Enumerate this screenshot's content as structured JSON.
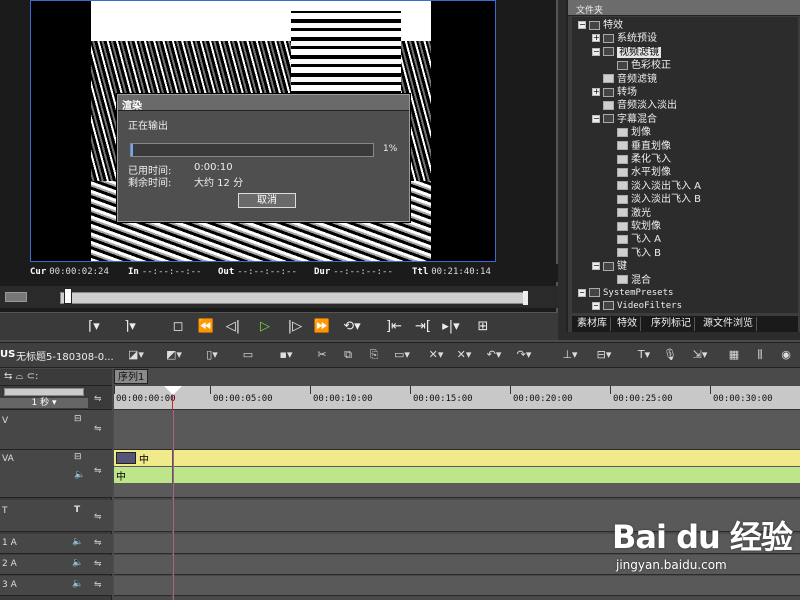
{
  "preview": {
    "timecodes": [
      {
        "label": "Cur",
        "value": "00:00:02:24"
      },
      {
        "label": "In",
        "value": "--:--:--:--"
      },
      {
        "label": "Out",
        "value": "--:--:--:--"
      },
      {
        "label": "Dur",
        "value": "--:--:--:--"
      },
      {
        "label": "Ttl",
        "value": "00:21:40:14"
      }
    ],
    "scrub_progress": 0.01
  },
  "dialog": {
    "title": "渲染",
    "status": "正在输出",
    "progress": 0.01,
    "progress_text": "1%",
    "elapsed_label": "已用时间:",
    "elapsed_value": "0:00:10",
    "remaining_label": "剩余时间:",
    "remaining_value": "大约 12 分",
    "cancel_label": "取消"
  },
  "folder_panel": {
    "title": "文件夹",
    "tree": [
      {
        "label": "特效",
        "level": 0,
        "toggle": "-",
        "icon": "folder"
      },
      {
        "label": "系统预设",
        "level": 1,
        "toggle": "+",
        "icon": "folder"
      },
      {
        "label": "视频滤镜",
        "level": 1,
        "toggle": "-",
        "icon": "folder",
        "selected": true
      },
      {
        "label": "色彩校正",
        "level": 2,
        "toggle": "",
        "icon": "folder"
      },
      {
        "label": "音频滤镜",
        "level": 1,
        "toggle": "",
        "icon": "fx"
      },
      {
        "label": "转场",
        "level": 1,
        "toggle": "+",
        "icon": "folder"
      },
      {
        "label": "音频淡入淡出",
        "level": 1,
        "toggle": "",
        "icon": "fx"
      },
      {
        "label": "字幕混合",
        "level": 1,
        "toggle": "-",
        "icon": "folder"
      },
      {
        "label": "划像",
        "level": 2,
        "toggle": "",
        "icon": "fx"
      },
      {
        "label": "垂直划像",
        "level": 2,
        "toggle": "",
        "icon": "fx"
      },
      {
        "label": "柔化飞入",
        "level": 2,
        "toggle": "",
        "icon": "fx"
      },
      {
        "label": "水平划像",
        "level": 2,
        "toggle": "",
        "icon": "fx"
      },
      {
        "label": "淡入淡出飞入 A",
        "level": 2,
        "toggle": "",
        "icon": "fx"
      },
      {
        "label": "淡入淡出飞入 B",
        "level": 2,
        "toggle": "",
        "icon": "fx"
      },
      {
        "label": "激光",
        "level": 2,
        "toggle": "",
        "icon": "fx"
      },
      {
        "label": "软划像",
        "level": 2,
        "toggle": "",
        "icon": "fx"
      },
      {
        "label": "飞入 A",
        "level": 2,
        "toggle": "",
        "icon": "fx"
      },
      {
        "label": "飞入 B",
        "level": 2,
        "toggle": "",
        "icon": "fx"
      },
      {
        "label": "键",
        "level": 1,
        "toggle": "-",
        "icon": "folder"
      },
      {
        "label": "混合",
        "level": 2,
        "toggle": "",
        "icon": "fx"
      },
      {
        "label": "SystemPresets",
        "level": 0,
        "toggle": "-",
        "icon": "folder",
        "mono": true
      },
      {
        "label": "VideoFilters",
        "level": 1,
        "toggle": "-",
        "icon": "folder",
        "mono": true
      }
    ],
    "tabs": [
      "素材库",
      "特效",
      "序列标记",
      "源文件浏览"
    ]
  },
  "toolbar": {
    "logo": "US",
    "project_title": "无标题5-180308-0..."
  },
  "timeline": {
    "sequence_tab": "序列1",
    "zoom_label": "1 秒",
    "ruler": [
      "00:00:00:00",
      "00:00:05:00",
      "00:00:10:00",
      "00:00:15:00",
      "00:00:20:00",
      "00:00:25:00",
      "00:00:30:00"
    ],
    "tracks": [
      {
        "name": "V"
      },
      {
        "name": "VA"
      },
      {
        "name": "T"
      },
      {
        "name": "1 A"
      },
      {
        "name": "2 A"
      },
      {
        "name": "3 A"
      }
    ],
    "video_clip_label": "中",
    "audio_clip_label": "中"
  },
  "watermark": {
    "logo": "Bai du 经验",
    "url": "jingyan.baidu.com"
  }
}
